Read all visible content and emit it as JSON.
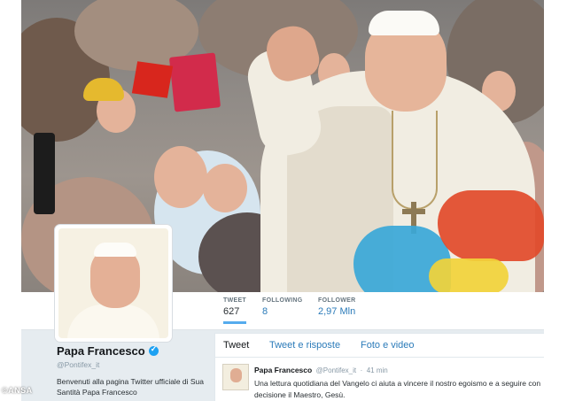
{
  "profile": {
    "name": "Papa Francesco",
    "handle": "@Pontifex_it",
    "bio": "Benvenuti alla pagina Twitter ufficiale di Sua Santità Papa Francesco"
  },
  "stats": [
    {
      "label": "TWEET",
      "value": "627"
    },
    {
      "label": "FOLLOWING",
      "value": "8"
    },
    {
      "label": "FOLLOWER",
      "value": "2,97 Mln"
    }
  ],
  "timeline_tabs": [
    "Tweet",
    "Tweet e risposte",
    "Foto e video"
  ],
  "tweet": {
    "author": "Papa Francesco",
    "handle": "@Pontifex_it",
    "time": "41 min",
    "text": "Una lettura quotidiana del Vangelo ci aiuta a vincere il nostro egoismo e a seguire con decisione il Maestro, Gesù."
  },
  "watermark": "©ANSA",
  "colors": {
    "accent": "#55acee",
    "link": "#2b7bb9",
    "verified": "#1da1f2",
    "background": "#e6ecf0"
  }
}
